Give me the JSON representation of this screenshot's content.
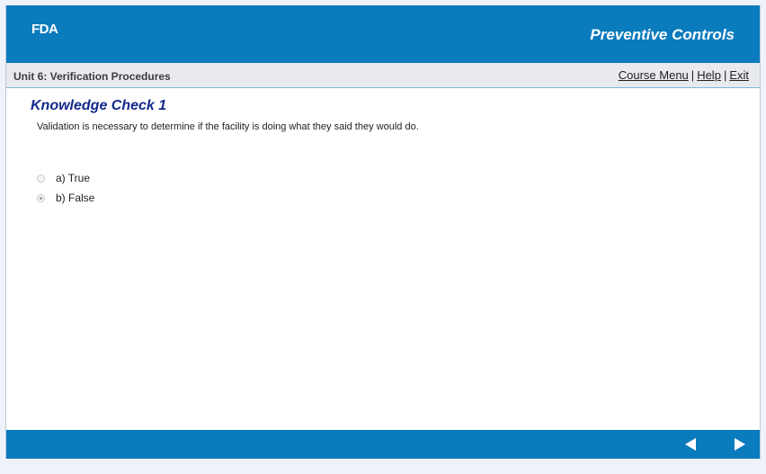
{
  "header": {
    "logo": "FDA",
    "app_title": "Preventive Controls"
  },
  "subbar": {
    "unit_title": "Unit 6: Verification Procedures",
    "links": {
      "course_menu": "Course Menu",
      "help": "Help",
      "exit": "Exit",
      "separator": "|"
    }
  },
  "content": {
    "title": "Knowledge Check 1",
    "question": "Validation is necessary to determine if the facility is doing what they said they would do.",
    "options": [
      {
        "label": "a) True",
        "selected": false
      },
      {
        "label": "b) False",
        "selected": true
      }
    ]
  },
  "footer": {
    "prev_icon": "left-triangle-arrow",
    "next_icon": "right-triangle-arrow"
  },
  "colors": {
    "header_blue": "#0a7bbd",
    "title_blue": "#14298a"
  }
}
